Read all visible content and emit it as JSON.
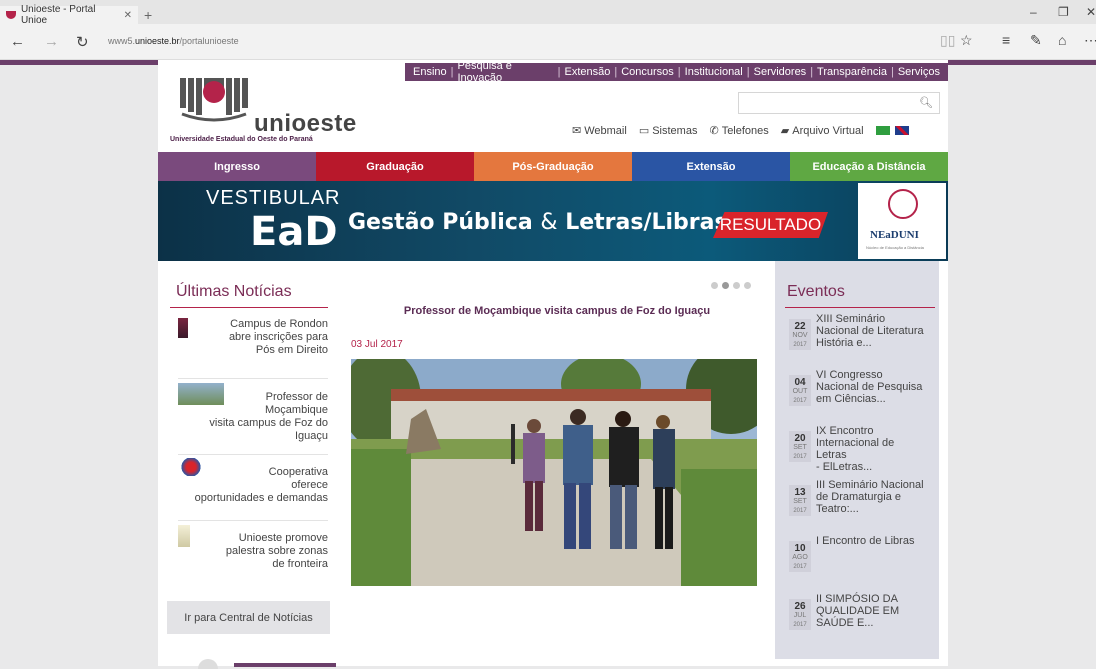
{
  "browser": {
    "tab_title": "Unioeste - Portal Unioe",
    "tab_close": "✕",
    "new_tab": "+",
    "url_prefix": "www5.",
    "url_domain": "unioeste.br",
    "url_path": "/portalunioeste",
    "minimize": "–",
    "restore": "❐",
    "close": "✕"
  },
  "topnav": [
    "Ensino",
    "Pesquisa e Inovação",
    "Extensão",
    "Concursos",
    "Institucional",
    "Servidores",
    "Transparência",
    "Serviços"
  ],
  "logo": {
    "word": "unioeste",
    "subtitle": "Universidade Estadual do Oeste do Paraná"
  },
  "search": {
    "placeholder": ""
  },
  "quicklinks": [
    {
      "label": "Webmail",
      "icon": "envelope-icon"
    },
    {
      "label": "Sistemas",
      "icon": "monitor-icon"
    },
    {
      "label": "Telefones",
      "icon": "phone-icon"
    },
    {
      "label": "Arquivo Virtual",
      "icon": "folder-icon"
    }
  ],
  "mainmenu": [
    {
      "label": "Ingresso",
      "color": "#7a4a7d"
    },
    {
      "label": "Graduação",
      "color": "#b8182b"
    },
    {
      "label": "Pós-Graduação",
      "color": "#e4773e"
    },
    {
      "label": "Extensão",
      "color": "#2a55a4"
    },
    {
      "label": "Educação a Distância",
      "color": "#5fa843"
    }
  ],
  "banner": {
    "line1": "VESTIBULAR",
    "line2": "EaD",
    "course_a": "Gestão Pública",
    "amp": "&",
    "course_b": "Letras/Libras",
    "result": "RESULTADO",
    "nead": "NEaDUNI",
    "nead_tiny": "Núcleo de Educação a Distância"
  },
  "news": {
    "title": "Últimas Notícias",
    "items": [
      {
        "lines": [
          "Campus de Rondon",
          "abre inscrições para",
          "Pós em Direito"
        ]
      },
      {
        "lines": [
          "Professor de",
          "Moçambique",
          "visita campus de Foz do",
          "Iguaçu"
        ]
      },
      {
        "lines": [
          "Cooperativa",
          "oferece",
          "oportunidades e demandas"
        ]
      },
      {
        "lines": [
          "Unioeste promove",
          "palestra sobre zonas",
          "de fronteira"
        ]
      }
    ],
    "all_button": "Ir para Central de Notícias"
  },
  "feature": {
    "title": "Professor de Moçambique visita campus de Foz do Iguaçu",
    "date": "03 Jul 2017",
    "slide_count": 4,
    "active_slide": 2
  },
  "events": {
    "title": "Eventos",
    "items": [
      {
        "day": "22",
        "mon": "NOV",
        "yr": "2017",
        "lines": [
          "XIII Seminário",
          "Nacional de Literatura",
          "História e..."
        ]
      },
      {
        "day": "04",
        "mon": "OUT",
        "yr": "2017",
        "lines": [
          "VI Congresso",
          "Nacional de Pesquisa",
          "em Ciências..."
        ]
      },
      {
        "day": "20",
        "mon": "SET",
        "yr": "2017",
        "lines": [
          "IX Encontro",
          "Internacional de Letras",
          "- ElLetras..."
        ]
      },
      {
        "day": "13",
        "mon": "SET",
        "yr": "2017",
        "lines": [
          "III Seminário Nacional",
          "de Dramaturgia e",
          "Teatro:..."
        ]
      },
      {
        "day": "10",
        "mon": "AGO",
        "yr": "2017",
        "lines": [
          "I Encontro de Libras"
        ]
      },
      {
        "day": "26",
        "mon": "JUL",
        "yr": "2017",
        "lines": [
          "II SIMPÓSIO DA",
          "QUALIDADE EM",
          "SAÚDE E..."
        ]
      }
    ]
  },
  "colors": {
    "brand_purple": "#6b3f6a",
    "brand_red": "#b4234a"
  }
}
